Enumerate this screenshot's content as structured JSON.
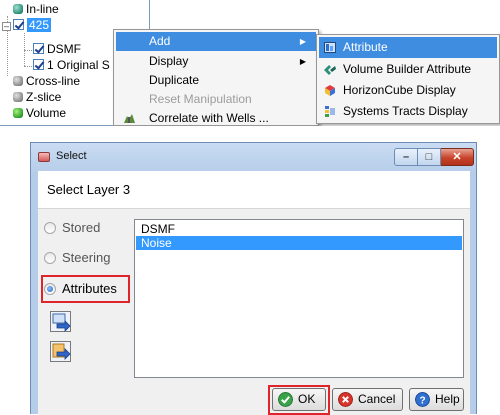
{
  "tree": {
    "items": [
      {
        "label": "In-line"
      },
      {
        "label": "425"
      },
      {
        "label": "DSMF"
      },
      {
        "label": "1 Original S"
      },
      {
        "label": "Cross-line"
      },
      {
        "label": "Z-slice"
      },
      {
        "label": "Volume"
      }
    ]
  },
  "context_menu": {
    "items": [
      {
        "label": "Add"
      },
      {
        "label": "Display"
      },
      {
        "label": "Duplicate"
      },
      {
        "label": "Reset Manipulation"
      },
      {
        "label": "Correlate with Wells ..."
      }
    ]
  },
  "add_submenu": {
    "items": [
      {
        "label": "Attribute"
      },
      {
        "label": "Volume Builder Attribute"
      },
      {
        "label": "HorizonCube Display"
      },
      {
        "label": "Systems Tracts Display"
      }
    ]
  },
  "dialog": {
    "title": "Select",
    "layer_title": "Select Layer 3",
    "radios": [
      {
        "label": "Stored",
        "selected": false
      },
      {
        "label": "Steering",
        "selected": false
      },
      {
        "label": "Attributes",
        "selected": true
      }
    ],
    "list_items": [
      {
        "label": "DSMF",
        "selected": false
      },
      {
        "label": "Noise",
        "selected": true
      }
    ],
    "buttons": {
      "ok": "OK",
      "cancel": "Cancel",
      "help": "Help"
    },
    "window_controls": {
      "minimize": "–",
      "maximize": "□",
      "close": "✕"
    }
  },
  "colors": {
    "highlight_box": "#e0242c",
    "selection": "#3399ff",
    "menu_highlight": "#3e8de0"
  }
}
